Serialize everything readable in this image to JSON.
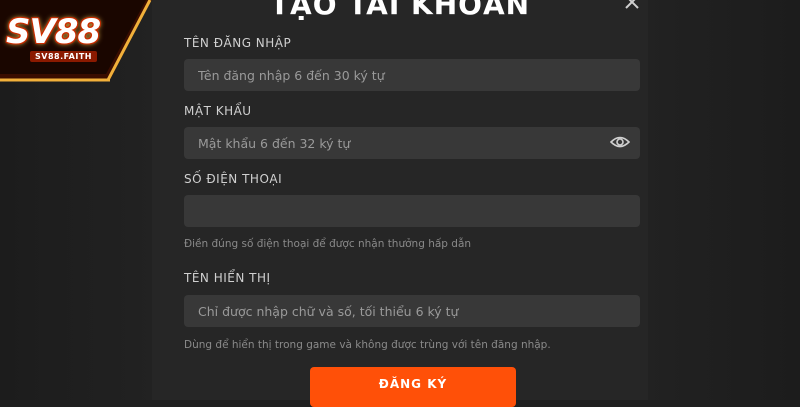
{
  "brand": {
    "logo_text": "SV88",
    "logo_subtext": "SV88.FAITH"
  },
  "modal": {
    "title": "TẠO TÀI KHOẢN",
    "close_icon": "close-icon"
  },
  "form": {
    "username": {
      "label": "TÊN ĐĂNG NHẬP",
      "value": "",
      "placeholder": "Tên đăng nhập 6 đến 30 ký tự"
    },
    "password": {
      "label": "MẬT KHẨU",
      "value": "",
      "placeholder": "Mật khẩu 6 đến 32 ký tự",
      "toggle_icon": "eye-icon"
    },
    "phone": {
      "label": "SỐ ĐIỆN THOẠI",
      "value": "",
      "placeholder": "",
      "helper": "Điền đúng số điện thoại để được nhận thưởng hấp dẫn"
    },
    "display_name": {
      "label": "TÊN HIỂN THỊ",
      "value": "",
      "placeholder": "Chỉ được nhập chữ và số, tối thiểu 6 ký tự",
      "helper": "Dùng để hiển thị trong game và không được trùng với tên đăng nhập."
    },
    "submit_label": "ĐĂNG KÝ"
  },
  "colors": {
    "accent": "#ff5008",
    "modal_bg": "#262626",
    "field_bg": "#383838"
  }
}
